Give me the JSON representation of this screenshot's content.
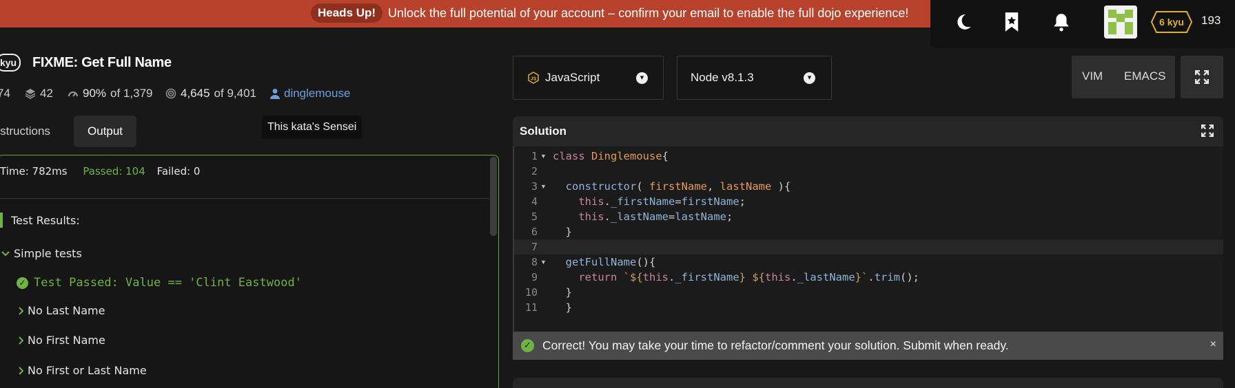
{
  "banner": {
    "pill": "Heads Up!",
    "message": "Unlock the full potential of your account – confirm your email to enable the full dojo experience!"
  },
  "user": {
    "rank": "6 kyu",
    "honor": "193",
    "icons": [
      "moon-icon",
      "bookmark-star-icon",
      "bell-icon",
      "avatar"
    ]
  },
  "kata": {
    "kyu": "kyu",
    "title": "FIXME: Get Full Name",
    "stats": {
      "stars": "74",
      "collections": "42",
      "satisfaction": "90%",
      "satisfaction_of": "of 1,379",
      "completed": "4,645",
      "completed_of": "of 9,401",
      "author": "dinglemouse"
    },
    "tooltip": "This kata's Sensei"
  },
  "tabs": [
    {
      "label": "Instructions",
      "active": false
    },
    {
      "label": "Output",
      "active": true
    }
  ],
  "output": {
    "time": "Time: 782ms",
    "passed": "Passed: 104",
    "failed": "Failed: 0",
    "results_title": "Test Results:",
    "group": "Simple tests",
    "passed_test": "Test Passed: Value == 'Clint Eastwood'",
    "collapsed_groups": [
      "No Last Name",
      "No First Name",
      "No First or Last Name"
    ]
  },
  "editor_settings": {
    "language": "JavaScript",
    "version": "Node v8.1.3",
    "keymaps": [
      "VIM",
      "EMACS"
    ]
  },
  "solution": {
    "title": "Solution",
    "line_numbers": [
      "1",
      "2",
      "3",
      "4",
      "5",
      "6",
      "7",
      "8",
      "9",
      "10",
      "11"
    ],
    "active_line": 7,
    "notice": "Correct! You may take your time to refactor/comment your solution. Submit when ready.",
    "close": "×"
  },
  "colors": {
    "banner": "#b8422b",
    "success": "#6fb344",
    "link": "#6d9fe0",
    "rank": "#e0b02c"
  }
}
